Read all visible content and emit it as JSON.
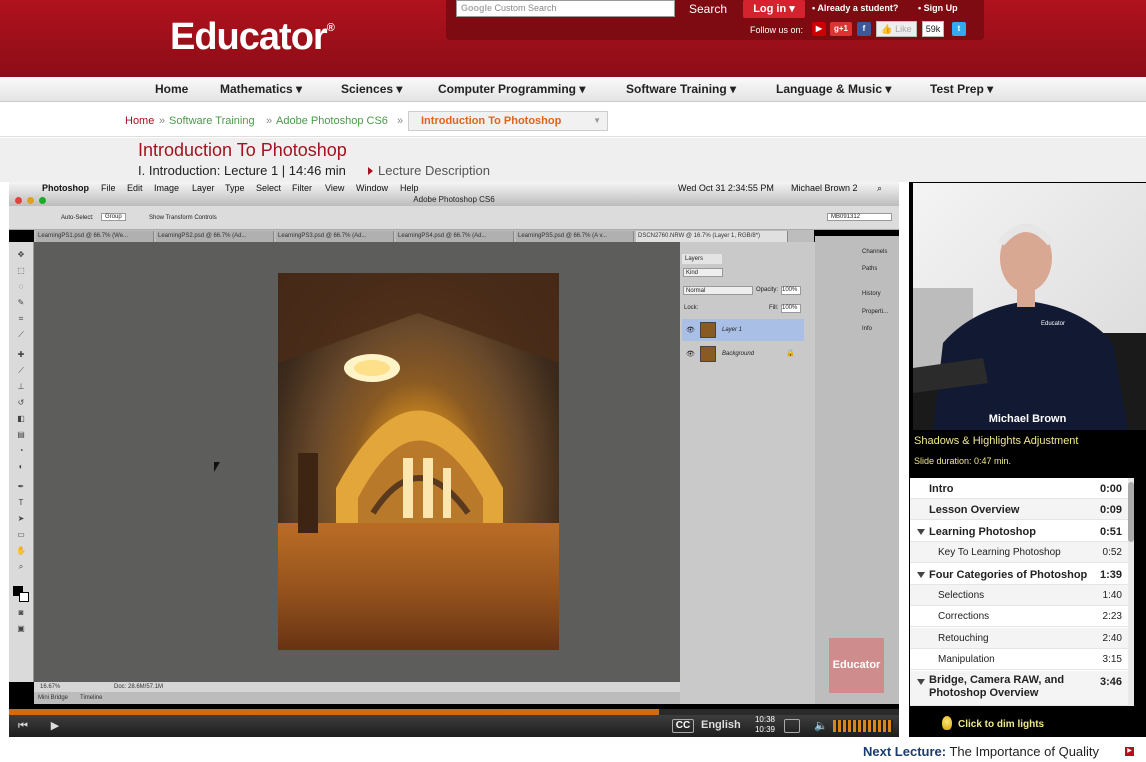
{
  "header": {
    "logo": "Educator",
    "logo_mark": "®",
    "search_placeholder": "Custom Search",
    "search_brand": "Google",
    "search_button": "Search",
    "login_button": "Log in ▾",
    "already_student": "• Already a student?",
    "sign_up": "• Sign Up",
    "follow_us": "Follow us on:",
    "like": "Like",
    "like_count": "59k"
  },
  "nav": {
    "items": [
      {
        "label": "Home"
      },
      {
        "label": "Mathematics ▾"
      },
      {
        "label": "Sciences ▾"
      },
      {
        "label": "Computer Programming ▾"
      },
      {
        "label": "Software Training ▾"
      },
      {
        "label": "Language & Music ▾"
      },
      {
        "label": "Test Prep ▾"
      }
    ]
  },
  "breadcrumb": {
    "home": "Home",
    "sep": "»",
    "software_training": "Software Training",
    "photoshop": "Adobe Photoshop CS6",
    "current": "Introduction To Photoshop"
  },
  "lecture": {
    "title": "Introduction To Photoshop",
    "subtitle": "I. Introduction: Lecture 1 | 14:46 min",
    "description_link": "Lecture Description"
  },
  "video": {
    "mac_menu": [
      "Photoshop",
      "File",
      "Edit",
      "Image",
      "Layer",
      "Type",
      "Select",
      "Filter",
      "View",
      "Window",
      "Help"
    ],
    "mac_clock": "Wed Oct 31  2:34:55 PM",
    "mac_user": "Michael Brown 2",
    "app_title": "Adobe Photoshop CS6",
    "options": {
      "auto_select": "Auto-Select:",
      "group": "Group",
      "transform": "Show Transform Controls",
      "workspace": "MB091312"
    },
    "doc_tabs": [
      "LearningPS1.psd @ 66.7% (We...",
      "LearningPS2.psd @ 66.7% (Ad...",
      "LearningPS3.psd @ 66.7% (Ad...",
      "LearningPS4.psd @ 66.7% (Ad...",
      "LearningPS5.psd @ 66.7% (A v...",
      "DSCN2760.NRW @ 16.7% (Layer 1, RGB/8*)"
    ],
    "status_zoom": "16.67%",
    "status_doc": "Doc: 28.6M/57.1M",
    "bottom_tabs": [
      "Mini Bridge",
      "Timeline"
    ],
    "layers_panel": {
      "title": "Layers",
      "kind": "Kind",
      "blend": "Normal",
      "opacity_label": "Opacity:",
      "opacity": "100%",
      "lock_label": "Lock:",
      "fill_label": "Fill:",
      "fill": "100%",
      "layers": [
        "Layer 1",
        "Background"
      ]
    },
    "dock": [
      "Channels",
      "Paths",
      "History",
      "Properti...",
      "Info"
    ],
    "watermark": "Educator",
    "progress": 0.73,
    "cc": "CC",
    "language": "English",
    "time_current": "10:38",
    "time_total": "10:39"
  },
  "sidebar": {
    "teacher_name": "Michael Brown",
    "shirt_logo": "Educator",
    "slide_title": "Shadows & Highlights Adjustment",
    "slide_duration": "Slide duration: 0:47 min.",
    "toc": [
      {
        "label": "Intro",
        "time": "0:00",
        "level": "top"
      },
      {
        "label": "Lesson Overview",
        "time": "0:09",
        "level": "top"
      },
      {
        "label": "Learning Photoshop",
        "time": "0:51",
        "level": "section"
      },
      {
        "label": "Key To Learning Photoshop",
        "time": "0:52",
        "level": "sub"
      },
      {
        "label": "Four Categories of Photoshop",
        "time": "1:39",
        "level": "section"
      },
      {
        "label": "Selections",
        "time": "1:40",
        "level": "sub"
      },
      {
        "label": "Corrections",
        "time": "2:23",
        "level": "sub"
      },
      {
        "label": "Retouching",
        "time": "2:40",
        "level": "sub"
      },
      {
        "label": "Manipulation",
        "time": "3:15",
        "level": "sub"
      },
      {
        "label": "Bridge, Camera RAW, and Photoshop Overview",
        "time": "3:46",
        "level": "section"
      }
    ],
    "dim_lights": "Click to dim lights"
  },
  "next_lecture": {
    "label": "Next Lecture:",
    "title": "The Importance of Quality"
  }
}
